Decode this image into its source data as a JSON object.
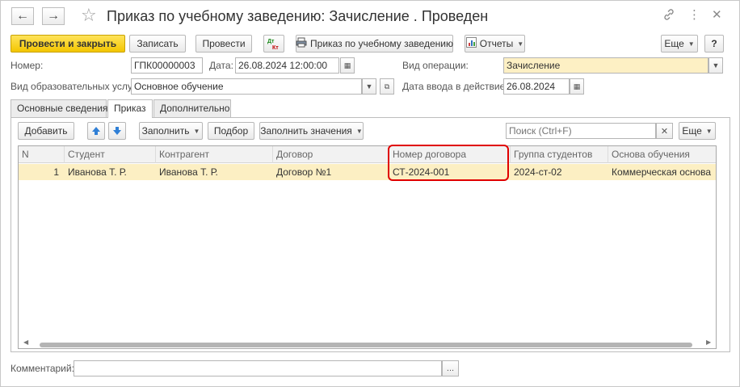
{
  "window": {
    "title": "Приказ по учебному заведению: Зачисление . Проведен"
  },
  "toolbar": {
    "post_close": "Провести и закрыть",
    "save": "Записать",
    "post": "Провести",
    "dtkt": "Дт\nКт",
    "print_order": "Приказ по учебному заведению",
    "reports": "Отчеты",
    "more": "Еще",
    "help": "?"
  },
  "form": {
    "number_label": "Номер:",
    "number_value": "ГПК00000003",
    "date_label": "Дата:",
    "date_value": "26.08.2024 12:00:00",
    "op_type_label": "Вид операции:",
    "op_type_value": "Зачисление",
    "service_type_label": "Вид образовательных услуг:",
    "service_type_value": "Основное обучение",
    "effective_date_label": "Дата ввода в действие:",
    "effective_date_value": "26.08.2024"
  },
  "tabs": [
    {
      "label": "Основные сведения",
      "active": false
    },
    {
      "label": "Приказ",
      "active": true
    },
    {
      "label": "Дополнительно",
      "active": false
    }
  ],
  "table_toolbar": {
    "add": "Добавить",
    "fill": "Заполнить",
    "select": "Подбор",
    "fill_values": "Заполнить значения",
    "search_placeholder": "Поиск (Ctrl+F)",
    "more": "Еще"
  },
  "table": {
    "columns": [
      "N",
      "Студент",
      "Контрагент",
      "Договор",
      "Номер договора",
      "Группа студентов",
      "Основа обучения"
    ],
    "rows": [
      [
        "1",
        "Иванова Т. Р.",
        "Иванова Т. Р.",
        "Договор №1",
        "СТ-2024-001",
        "2024-ст-02",
        "Коммерческая основа"
      ]
    ]
  },
  "footer": {
    "comment_label": "Комментарий:",
    "comment_value": "",
    "comment_button": "..."
  },
  "colors": {
    "primary_button": "#f3c600",
    "selected_row": "#fcefc3",
    "highlight_frame": "#e00000",
    "arrow_blue": "#2f7fd6"
  }
}
